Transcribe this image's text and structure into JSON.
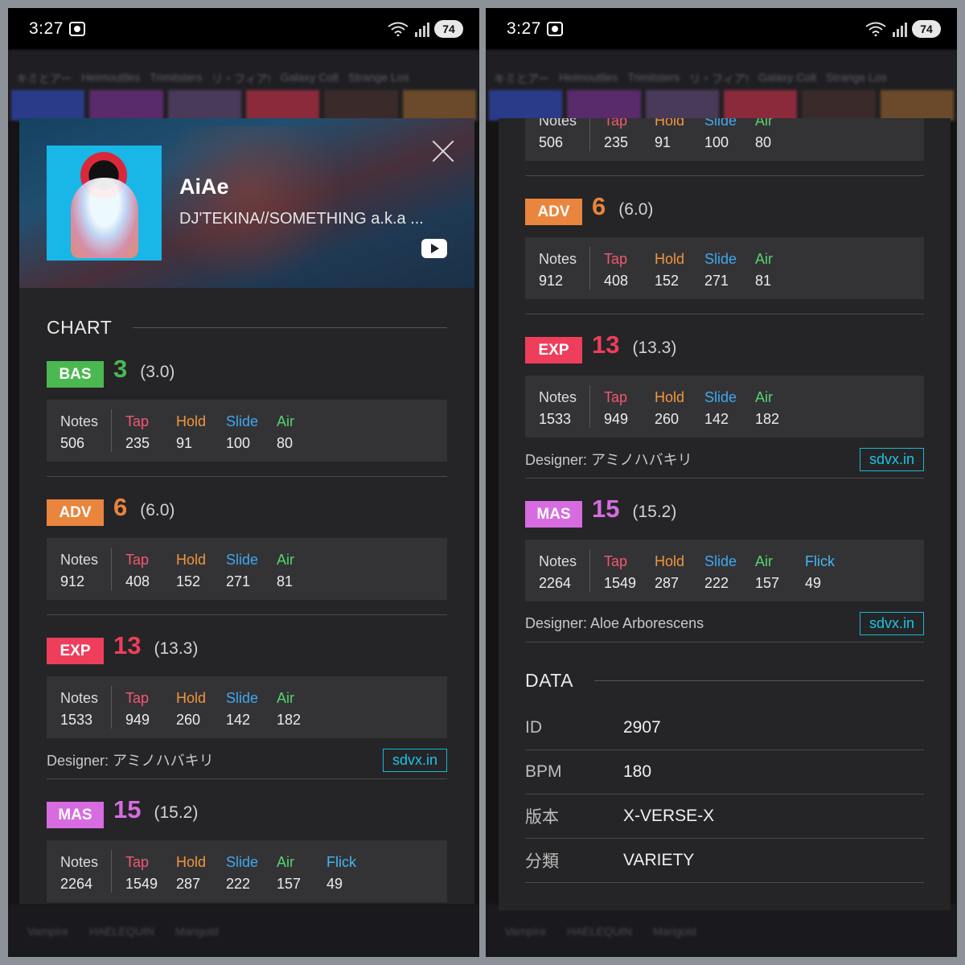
{
  "status": {
    "time": "3:27",
    "battery": "74"
  },
  "background": {
    "tabs": [
      "キミとアー",
      "Heimoutlles",
      "Trimitsters",
      "リ・フィア!",
      "Galaxy Colt",
      "Strange Los"
    ],
    "bottom_tabs": [
      "Vampire",
      "HAELEQUIN",
      "Marigold"
    ]
  },
  "song": {
    "title": "AiAe",
    "artist": "DJ'TEKINA//SOMETHING a.k.a ..."
  },
  "chart": {
    "heading": "CHART",
    "note_labels": {
      "notes": "Notes",
      "tap": "Tap",
      "hold": "Hold",
      "slide": "Slide",
      "air": "Air",
      "flick": "Flick"
    },
    "designer_prefix": "Designer: ",
    "link_label": "sdvx.in",
    "difficulties": [
      {
        "badge": "BAS",
        "color": "#4cb851",
        "level": "3",
        "const": "(3.0)",
        "notes": "506",
        "tap": "235",
        "hold": "91",
        "slide": "100",
        "air": "80"
      },
      {
        "badge": "ADV",
        "color": "#e9853c",
        "level": "6",
        "const": "(6.0)",
        "notes": "912",
        "tap": "408",
        "hold": "152",
        "slide": "271",
        "air": "81"
      },
      {
        "badge": "EXP",
        "color": "#ee3e5c",
        "level": "13",
        "const": "(13.3)",
        "notes": "1533",
        "tap": "949",
        "hold": "260",
        "slide": "142",
        "air": "182",
        "designer": "Designer: アミノハバキリ"
      },
      {
        "badge": "MAS",
        "color": "#d76ce0",
        "level": "15",
        "const": "(15.2)",
        "notes": "2264",
        "tap": "1549",
        "hold": "287",
        "slide": "222",
        "air": "157",
        "flick": "49",
        "designer": "Designer: Aloe Arborescens"
      }
    ]
  },
  "data": {
    "heading": "DATA",
    "rows": [
      {
        "key": "ID",
        "value": "2907"
      },
      {
        "key": "BPM",
        "value": "180"
      },
      {
        "key": "版本",
        "value": "X-VERSE-X"
      },
      {
        "key": "分類",
        "value": "VARIETY"
      }
    ]
  }
}
